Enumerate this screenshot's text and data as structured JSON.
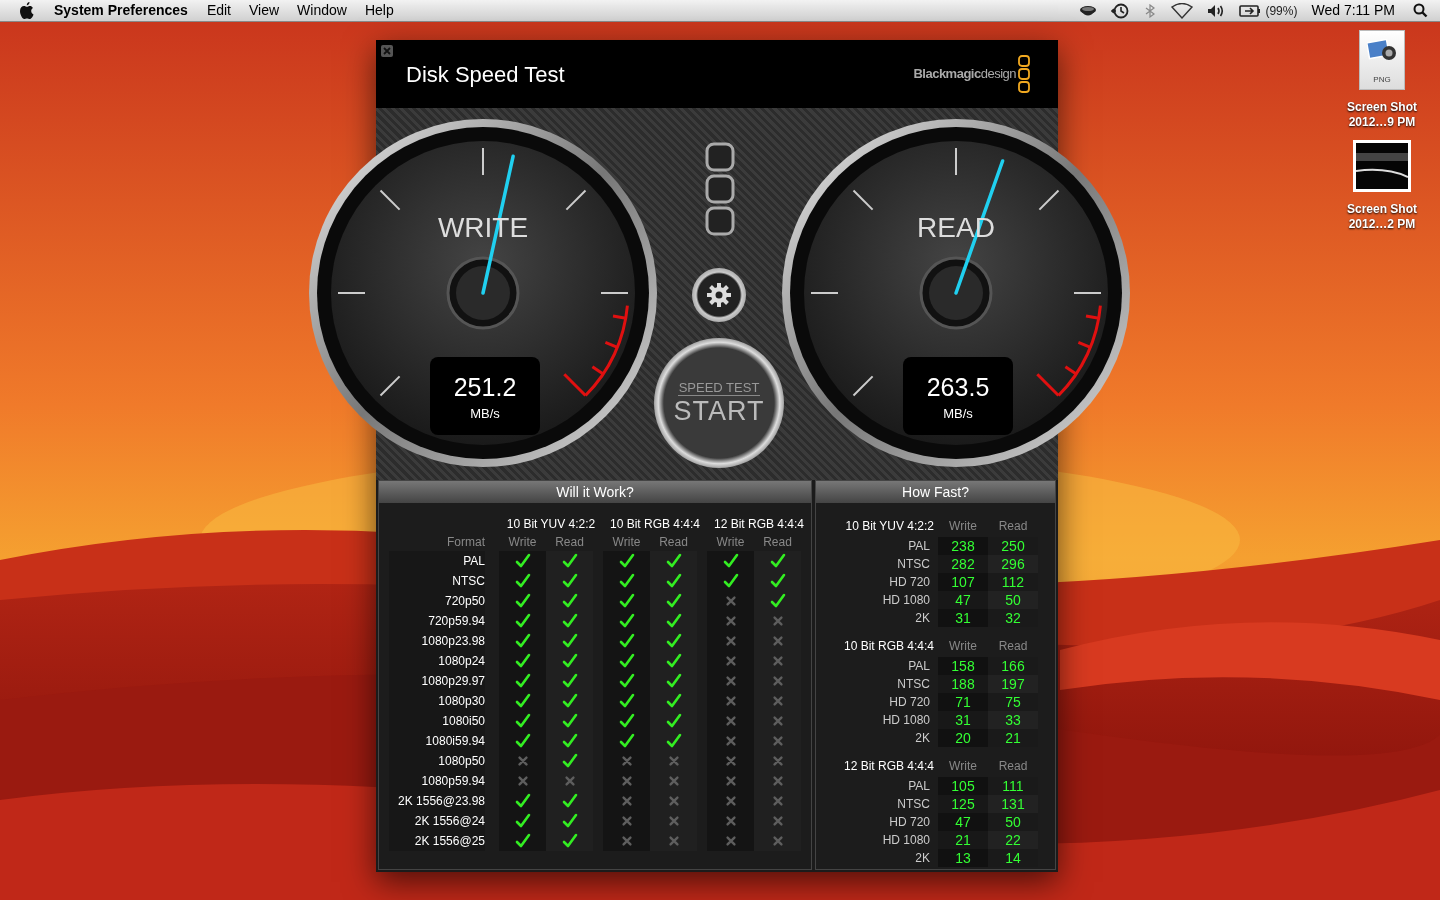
{
  "menu_bar": {
    "app_name": "System Preferences",
    "items": [
      "Edit",
      "View",
      "Window",
      "Help"
    ],
    "battery": "(99%)",
    "clock": "Wed 7:11 PM"
  },
  "desktop_icons": [
    {
      "kind": "document",
      "badge": "PNG",
      "lines": [
        "Screen Shot",
        "2012…9 PM"
      ]
    },
    {
      "lines": [
        "Screen Shot",
        "2012…2 PM"
      ]
    }
  ],
  "window": {
    "title": "Disk Speed Test",
    "logo": "**Blackmagic**design"
  },
  "gauges": [
    {
      "label": "WRITE",
      "value": "251.2",
      "unit": "MB/s",
      "level": 0.546
    },
    {
      "label": "READ",
      "value": "263.5",
      "unit": "MB/s",
      "level": 0.572
    }
  ],
  "start_button": {
    "caption": "SPEED TEST",
    "label": "START"
  },
  "will_it_work": {
    "title": "Will it Work?",
    "format_header": "Format",
    "groups": [
      {
        "name": "10 Bit YUV 4:2:2",
        "columns": [
          "Write",
          "Read"
        ]
      },
      {
        "name": "10 Bit RGB 4:4:4",
        "columns": [
          "Write",
          "Read"
        ]
      },
      {
        "name": "12 Bit RGB 4:4:4",
        "columns": [
          "Write",
          "Read"
        ]
      }
    ],
    "rows": [
      {
        "format": "PAL",
        "supported": [
          true,
          true,
          true,
          true,
          true,
          true
        ]
      },
      {
        "format": "NTSC",
        "supported": [
          true,
          true,
          true,
          true,
          true,
          true
        ]
      },
      {
        "format": "720p50",
        "supported": [
          true,
          true,
          true,
          true,
          false,
          true
        ]
      },
      {
        "format": "720p59.94",
        "supported": [
          true,
          true,
          true,
          true,
          false,
          false
        ]
      },
      {
        "format": "1080p23.98",
        "supported": [
          true,
          true,
          true,
          true,
          false,
          false
        ]
      },
      {
        "format": "1080p24",
        "supported": [
          true,
          true,
          true,
          true,
          false,
          false
        ]
      },
      {
        "format": "1080p29.97",
        "supported": [
          true,
          true,
          true,
          true,
          false,
          false
        ]
      },
      {
        "format": "1080p30",
        "supported": [
          true,
          true,
          true,
          true,
          false,
          false
        ]
      },
      {
        "format": "1080i50",
        "supported": [
          true,
          true,
          true,
          true,
          false,
          false
        ]
      },
      {
        "format": "1080i59.94",
        "supported": [
          true,
          true,
          true,
          true,
          false,
          false
        ]
      },
      {
        "format": "1080p50",
        "supported": [
          false,
          true,
          false,
          false,
          false,
          false
        ]
      },
      {
        "format": "1080p59.94",
        "supported": [
          false,
          false,
          false,
          false,
          false,
          false
        ]
      },
      {
        "format": "2K 1556@23.98",
        "supported": [
          true,
          true,
          false,
          false,
          false,
          false
        ]
      },
      {
        "format": "2K 1556@24",
        "supported": [
          true,
          true,
          false,
          false,
          false,
          false
        ]
      },
      {
        "format": "2K 1556@25",
        "supported": [
          true,
          true,
          false,
          false,
          false,
          false
        ]
      }
    ]
  },
  "how_fast": {
    "title": "How Fast?",
    "groups": [
      {
        "name": "10 Bit YUV 4:2:2",
        "write_header": "Write",
        "read_header": "Read",
        "rows": [
          {
            "format": "PAL",
            "write": "238",
            "read": "250"
          },
          {
            "format": "NTSC",
            "write": "282",
            "read": "296"
          },
          {
            "format": "HD 720",
            "write": "107",
            "read": "112"
          },
          {
            "format": "HD 1080",
            "write": "47",
            "read": "50"
          },
          {
            "format": "2K",
            "write": "31",
            "read": "32"
          }
        ]
      },
      {
        "name": "10 Bit RGB 4:4:4",
        "write_header": "Write",
        "read_header": "Read",
        "rows": [
          {
            "format": "PAL",
            "write": "158",
            "read": "166"
          },
          {
            "format": "NTSC",
            "write": "188",
            "read": "197"
          },
          {
            "format": "HD 720",
            "write": "71",
            "read": "75"
          },
          {
            "format": "HD 1080",
            "write": "31",
            "read": "33"
          },
          {
            "format": "2K",
            "write": "20",
            "read": "21"
          }
        ]
      },
      {
        "name": "12 Bit RGB 4:4:4",
        "write_header": "Write",
        "read_header": "Read",
        "rows": [
          {
            "format": "PAL",
            "write": "105",
            "read": "111"
          },
          {
            "format": "NTSC",
            "write": "125",
            "read": "131"
          },
          {
            "format": "HD 720",
            "write": "47",
            "read": "50"
          },
          {
            "format": "HD 1080",
            "write": "21",
            "read": "22"
          },
          {
            "format": "2K",
            "write": "13",
            "read": "14"
          }
        ]
      }
    ]
  }
}
